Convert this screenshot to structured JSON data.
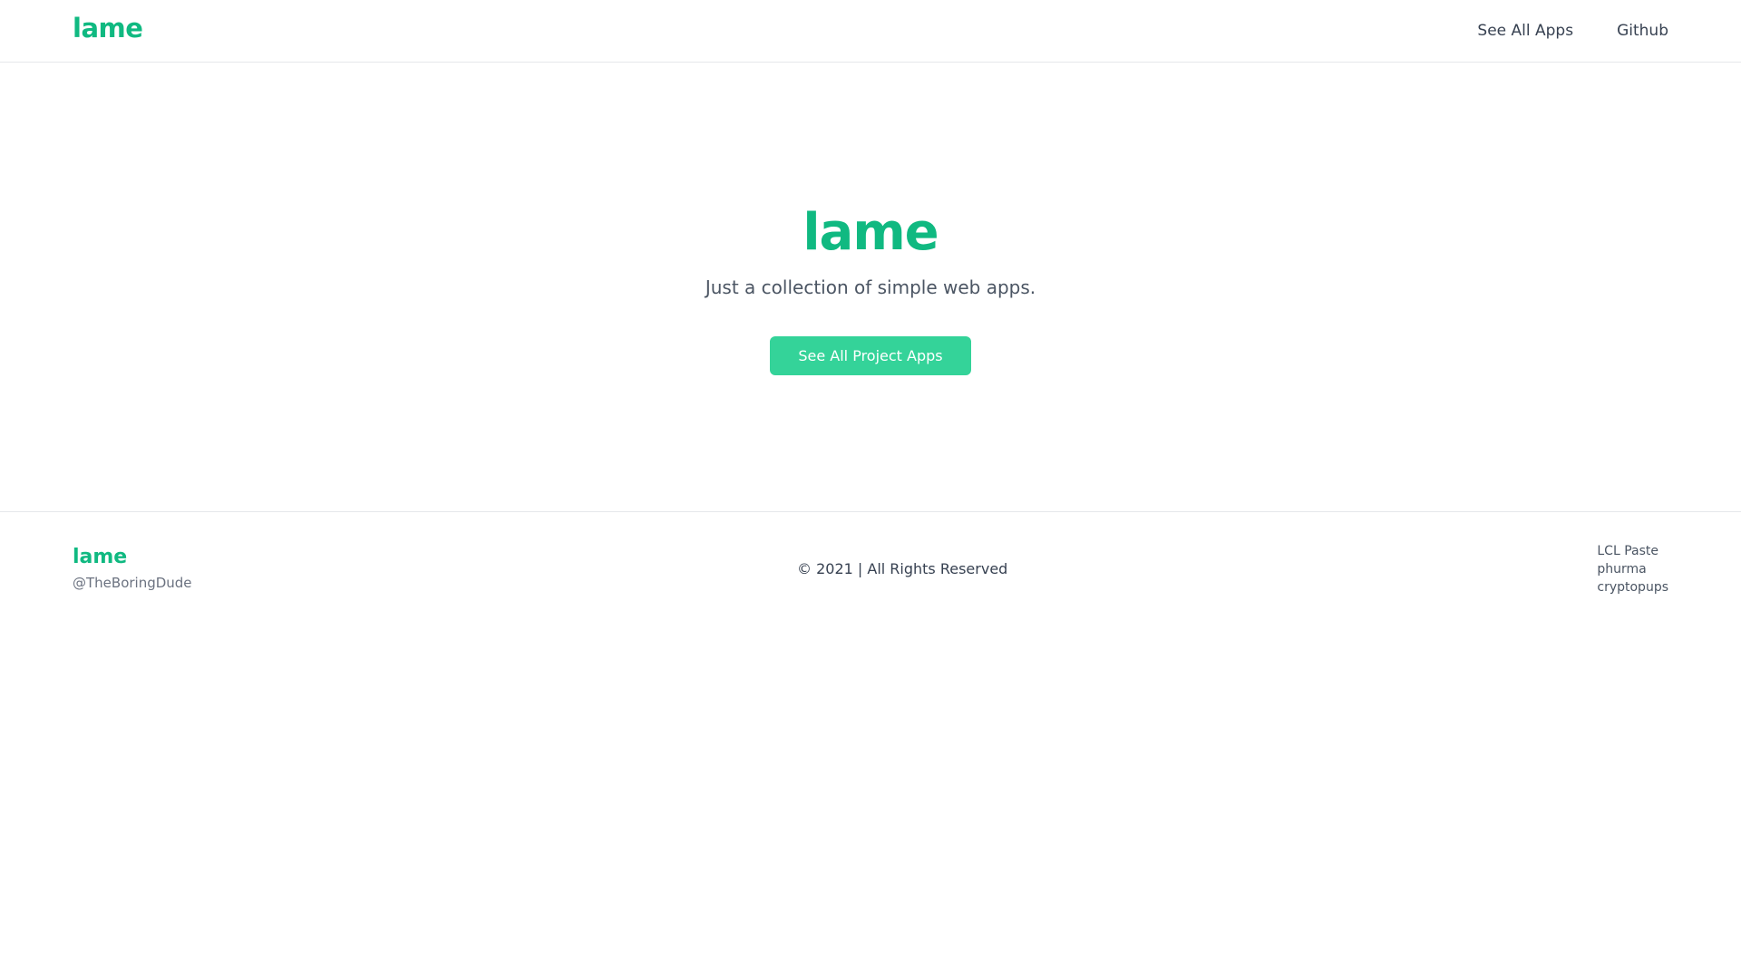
{
  "header": {
    "brand": "lame",
    "nav": [
      {
        "label": "See All Apps"
      },
      {
        "label": "Github"
      }
    ]
  },
  "hero": {
    "title": "lame",
    "subtitle": "Just a collection of simple web apps.",
    "cta_label": "See All Project Apps"
  },
  "footer": {
    "brand": "lame",
    "handle": "@TheBoringDude",
    "copyright": "© 2021 | All Rights Reserved",
    "links": [
      {
        "label": "LCL Paste"
      },
      {
        "label": "phurma"
      },
      {
        "label": "cryptopups"
      }
    ]
  },
  "colors": {
    "brand": "#10b981",
    "button": "#34d399"
  }
}
